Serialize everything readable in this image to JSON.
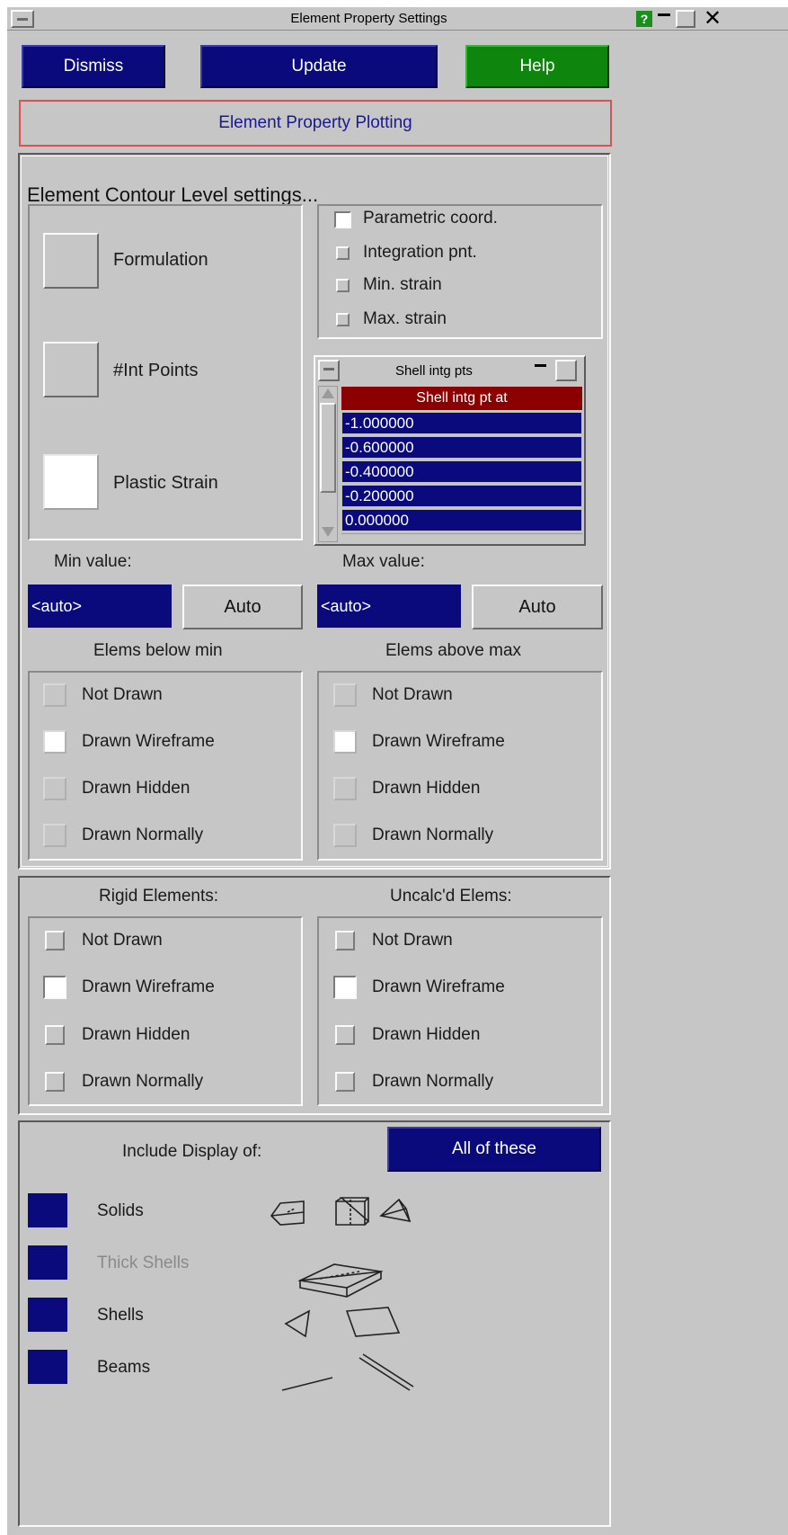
{
  "window": {
    "title": "Element Property Settings",
    "help_glyph": "?",
    "close_glyph": "✕"
  },
  "toolbar": {
    "dismiss": "Dismiss",
    "update": "Update",
    "help": "Help"
  },
  "banner": "Element Property Plotting",
  "contour": {
    "heading": "Element Contour Level settings...",
    "options": [
      {
        "label": "Formulation",
        "selected": false
      },
      {
        "label": "#Int Points",
        "selected": false
      },
      {
        "label": "Plastic Strain",
        "selected": true
      }
    ],
    "coord_options": [
      {
        "label": "Parametric coord.",
        "checked": true
      },
      {
        "label": "Integration pnt.",
        "checked": false
      },
      {
        "label": "Min. strain",
        "checked": false
      },
      {
        "label": "Max. strain",
        "checked": false
      }
    ],
    "shell_list": {
      "title": "Shell intg pts",
      "header": "Shell intg pt at",
      "rows": [
        "-1.000000",
        "-0.600000",
        "-0.400000",
        "-0.200000",
        "0.000000"
      ]
    },
    "min": {
      "label": "Min value:",
      "value": "<auto>",
      "button": "Auto"
    },
    "max": {
      "label": "Max value:",
      "value": "<auto>",
      "button": "Auto"
    },
    "below_min": {
      "title": "Elems below min",
      "options": [
        {
          "label": "Not Drawn",
          "checked": false
        },
        {
          "label": "Drawn Wireframe",
          "checked": true
        },
        {
          "label": "Drawn Hidden",
          "checked": false
        },
        {
          "label": "Drawn Normally",
          "checked": false
        }
      ]
    },
    "above_max": {
      "title": "Elems above max",
      "options": [
        {
          "label": "Not Drawn",
          "checked": false
        },
        {
          "label": "Drawn Wireframe",
          "checked": true
        },
        {
          "label": "Drawn Hidden",
          "checked": false
        },
        {
          "label": "Drawn Normally",
          "checked": false
        }
      ]
    }
  },
  "rigid": {
    "title": "Rigid Elements:",
    "options": [
      {
        "label": "Not Drawn",
        "checked": false
      },
      {
        "label": "Drawn Wireframe",
        "checked": true
      },
      {
        "label": "Drawn Hidden",
        "checked": false
      },
      {
        "label": "Drawn Normally",
        "checked": false
      }
    ]
  },
  "uncalc": {
    "title": "Uncalc'd Elems:",
    "options": [
      {
        "label": "Not Drawn",
        "checked": false
      },
      {
        "label": "Drawn Wireframe",
        "checked": true
      },
      {
        "label": "Drawn Hidden",
        "checked": false
      },
      {
        "label": "Drawn Normally",
        "checked": false
      }
    ]
  },
  "include": {
    "title": "Include Display of:",
    "all_button": "All of these",
    "items": [
      {
        "label": "Solids",
        "enabled": true
      },
      {
        "label": "Thick Shells",
        "enabled": false
      },
      {
        "label": "Shells",
        "enabled": true
      },
      {
        "label": "Beams",
        "enabled": true
      }
    ]
  },
  "colors": {
    "panel": "#c6c6c6",
    "button_blue": "#0a0a7d",
    "help_green": "#0e860e",
    "list_header": "#8b0000",
    "label_blue": "#1a1a8f",
    "banner_border": "#e05050"
  }
}
